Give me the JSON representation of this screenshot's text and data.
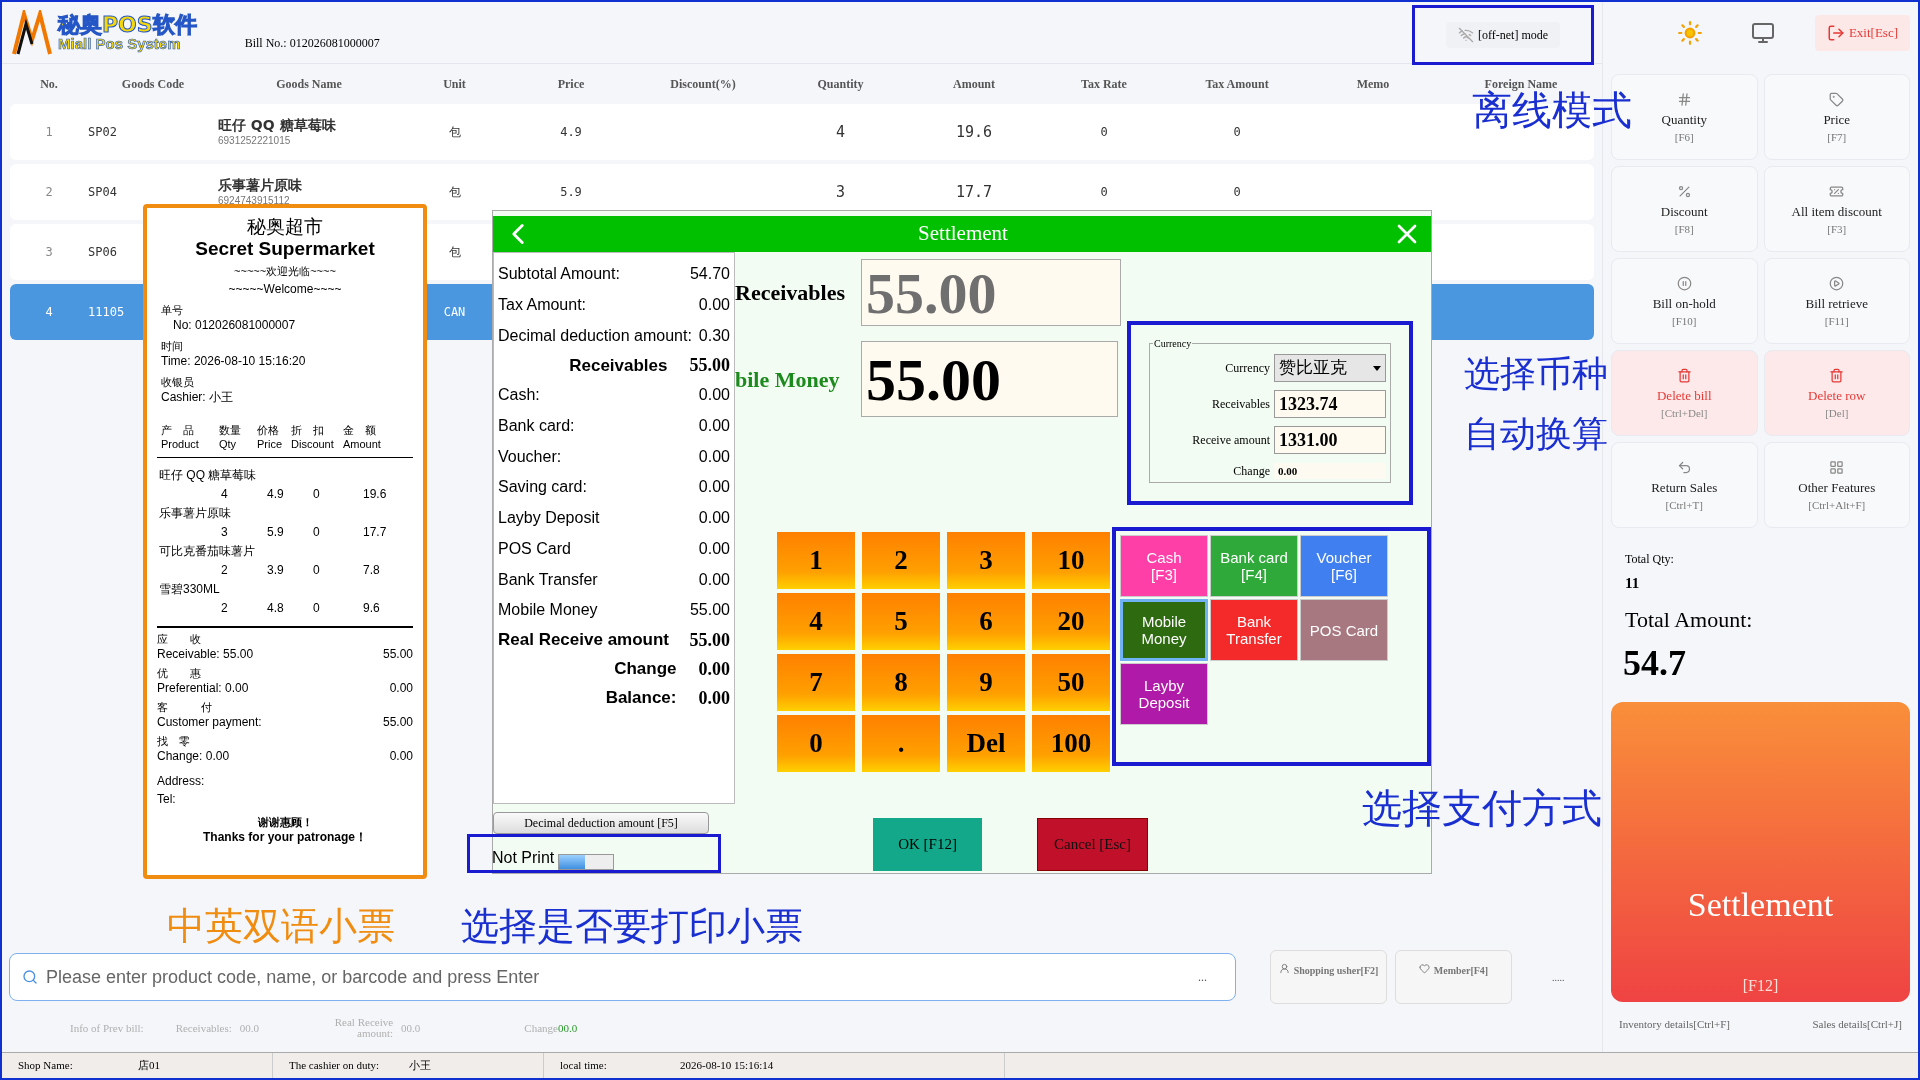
{
  "header": {
    "logo_cn": "秘奥POS软件",
    "logo_en": "Miall Pos System",
    "bill_no": "Bill No.: 012026081000007",
    "offline": "[off-net] mode",
    "exit": "Exit[Esc]"
  },
  "table": {
    "columns": [
      "No.",
      "Goods Code",
      "Goods Name",
      "Unit",
      "Price",
      "Discount(%)",
      "Quantity",
      "Amount",
      "Tax Rate",
      "Tax Amount",
      "Memo",
      "Foreign Name"
    ],
    "rows": [
      {
        "no": "1",
        "code": "SP02",
        "name": "旺仔 QQ 糖草莓味",
        "barcode": "6931252221015",
        "unit": "包",
        "price": "4.9",
        "quantity": "4",
        "amount": "19.6",
        "tax_rate": "0",
        "tax_amount": "0",
        "selected": false
      },
      {
        "no": "2",
        "code": "SP04",
        "name": "乐事薯片原味",
        "barcode": "6924743915112",
        "unit": "包",
        "price": "5.9",
        "quantity": "3",
        "amount": "17.7",
        "tax_rate": "0",
        "tax_amount": "0",
        "selected": false
      },
      {
        "no": "3",
        "code": "SP06",
        "unit": "包",
        "selected": false
      },
      {
        "no": "4",
        "code": "11105",
        "unit": "CAN",
        "selected": true
      }
    ]
  },
  "receipt": {
    "title_cn": "秘奥超市",
    "title_en": "Secret Supermarket",
    "welcome_cn": "~~~~~欢迎光临~~~~",
    "welcome_en": "~~~~~Welcome~~~~",
    "fields": [
      {
        "label": "单号",
        "value": "No: 012026081000007"
      },
      {
        "label": "时间",
        "value": "Time: 2026-08-10 15:16:20"
      },
      {
        "label": "收银员",
        "value": "Cashier: 小王"
      }
    ],
    "columns": [
      {
        "cn": "产　品",
        "en": "Product"
      },
      {
        "cn": "数量",
        "en": "Qty"
      },
      {
        "cn": "价格",
        "en": "Price"
      },
      {
        "cn": "折　扣",
        "en": "Discount"
      },
      {
        "cn": "金　额",
        "en": "Amount"
      }
    ],
    "items": [
      {
        "name": "旺仔 QQ 糖草莓味",
        "qty": "4",
        "price": "4.9",
        "discount": "0",
        "amount": "19.6"
      },
      {
        "name": "乐事薯片原味",
        "qty": "3",
        "price": "5.9",
        "discount": "0",
        "amount": "17.7"
      },
      {
        "name": "可比克番茄味薯片",
        "qty": "2",
        "price": "3.9",
        "discount": "0",
        "amount": "7.8"
      },
      {
        "name": "雪碧330ML",
        "qty": "2",
        "price": "4.8",
        "discount": "0",
        "amount": "9.6"
      }
    ],
    "totals": [
      {
        "cn": "应　　收",
        "label": "Receivable: 55.00",
        "value": "55.00"
      },
      {
        "cn": "优　　惠",
        "label": "Preferential: 0.00",
        "value": "0.00"
      },
      {
        "cn": "客　　　付",
        "label": "Customer payment:",
        "value": "55.00"
      },
      {
        "cn": "找　零",
        "label": "Change: 0.00",
        "value": "0.00"
      }
    ],
    "address": "Address:",
    "tel": "Tel:",
    "thanks_cn": "谢谢惠顾！",
    "thanks_en": "Thanks for your patronage！"
  },
  "settlement": {
    "title": "Settlement",
    "summary": [
      {
        "label": "Subtotal Amount:",
        "value": "54.70",
        "kind": "plain"
      },
      {
        "label": "Tax Amount:",
        "value": "0.00",
        "kind": "plain"
      },
      {
        "label": "Decimal deduction amount:",
        "value": "0.30",
        "kind": "plain"
      },
      {
        "label": "Receivables",
        "value": "55.00",
        "kind": "total"
      },
      {
        "label": "Cash:",
        "value": "0.00",
        "kind": "plain"
      },
      {
        "label": "Bank card:",
        "value": "0.00",
        "kind": "plain"
      },
      {
        "label": "Voucher:",
        "value": "0.00",
        "kind": "plain"
      },
      {
        "label": "Saving card:",
        "value": "0.00",
        "kind": "plain"
      },
      {
        "label": "Layby Deposit",
        "value": "0.00",
        "kind": "plain"
      },
      {
        "label": "POS Card",
        "value": "0.00",
        "kind": "plain"
      },
      {
        "label": "Bank Transfer",
        "value": "0.00",
        "kind": "plain"
      },
      {
        "label": "Mobile Money",
        "value": "55.00",
        "kind": "plain"
      },
      {
        "label": "Real Receive amount",
        "value": "55.00",
        "kind": "strong"
      },
      {
        "label": "Change",
        "value": "0.00",
        "kind": "total"
      },
      {
        "label": "Balance:",
        "value": "0.00",
        "kind": "total"
      }
    ],
    "decimal_button": "Decimal deduction amount [F5]",
    "print": {
      "label": "Not Print",
      "on": false
    },
    "receivables_label": "Receivables",
    "receivables_value": "55.00",
    "payment_label": "bile Money",
    "payment_value": "55.00",
    "currency": {
      "legend": "Currency",
      "select_label": "Currency",
      "select_value": "赞比亚克",
      "receivables_label": "Receivables",
      "receivables_value": "1323.74",
      "receive_label": "Receive amount",
      "receive_value": "1331.00",
      "change_label": "Change",
      "change_value": "0.00"
    },
    "keys": [
      "1",
      "2",
      "3",
      "10",
      "4",
      "5",
      "6",
      "20",
      "7",
      "8",
      "9",
      "50",
      "0",
      ".",
      "Del",
      "100"
    ],
    "payments": [
      {
        "label": "Cash",
        "shortcut": "[F3]",
        "color": "#ff3fa8",
        "selected": false
      },
      {
        "label": "Bank card",
        "shortcut": "[F4]",
        "color": "#2faa3a",
        "selected": false
      },
      {
        "label": "Voucher",
        "shortcut": "[F6]",
        "color": "#3f7fef",
        "selected": false
      },
      {
        "label": "Mobile Money",
        "color": "#2e6a10",
        "selected": true
      },
      {
        "label": "Bank Transfer",
        "color": "#f42a2a",
        "selected": false
      },
      {
        "label": "POS Card",
        "color": "#a87880",
        "selected": false
      },
      {
        "label": "Layby Deposit",
        "color": "#b01aa8",
        "selected": false
      }
    ],
    "ok": "OK [F12]",
    "cancel": "Cancel [Esc]"
  },
  "side": {
    "buttons": [
      {
        "label": "Quantity",
        "shortcut": "[F6]",
        "kind": "normal"
      },
      {
        "label": "Price",
        "shortcut": "[F7]",
        "kind": "normal"
      },
      {
        "label": "Discount",
        "shortcut": "[F8]",
        "kind": "normal"
      },
      {
        "label": "All item discount",
        "shortcut": "[F3]",
        "kind": "normal"
      },
      {
        "label": "Bill on-hold",
        "shortcut": "[F10]",
        "kind": "normal"
      },
      {
        "label": "Bill retrieve",
        "shortcut": "[F11]",
        "kind": "normal"
      },
      {
        "label": "Delete bill",
        "shortcut": "[Ctrl+Del]",
        "kind": "danger"
      },
      {
        "label": "Delete row",
        "shortcut": "[Del]",
        "kind": "danger"
      },
      {
        "label": "Return Sales",
        "shortcut": "[Ctrl+T]",
        "kind": "normal"
      },
      {
        "label": "Other Features",
        "shortcut": "[Ctrl+Alt+F]",
        "kind": "normal"
      }
    ],
    "total_qty_label": "Total Qty:",
    "total_qty": "11",
    "total_amount_label": "Total Amount:",
    "total_amount": "54.7",
    "settle": "Settlement",
    "settle_key": "[F12]",
    "links": [
      "Inventory details[Ctrl+F]",
      "Sales details[Ctrl+J]"
    ]
  },
  "search": {
    "placeholder": "Please enter product code, name, or barcode and press Enter",
    "more": "...",
    "buttons": [
      "Shopping usher[F2]",
      "Member[F4]"
    ],
    "ellipsis": "....."
  },
  "prev_bill": {
    "title": "Info of Prev bill:",
    "receivables_label": "Receivables:",
    "receivables": "00.0",
    "real_label": "Real Receive amount:",
    "real": "00.0",
    "change_label": "Change",
    "change": "00.0"
  },
  "status_bar": [
    {
      "label": "Shop Name:",
      "value": "店01"
    },
    {
      "label": "The cashier on duty:",
      "value": "小王"
    },
    {
      "label": "local time:",
      "value": "2026-08-10 15:16:14"
    }
  ],
  "annotations": [
    {
      "text": "离线模式",
      "color": "#1a2fd0"
    },
    {
      "text": "选择币种",
      "color": "#1a2fd0"
    },
    {
      "text": "自动换算",
      "color": "#1a2fd0"
    },
    {
      "text": "选择支付方式",
      "color": "#1a2fd0"
    },
    {
      "text": "中英双语小票",
      "color": "#f08c10"
    },
    {
      "text": "选择是否要打印小票",
      "color": "#1a2fd0"
    }
  ]
}
